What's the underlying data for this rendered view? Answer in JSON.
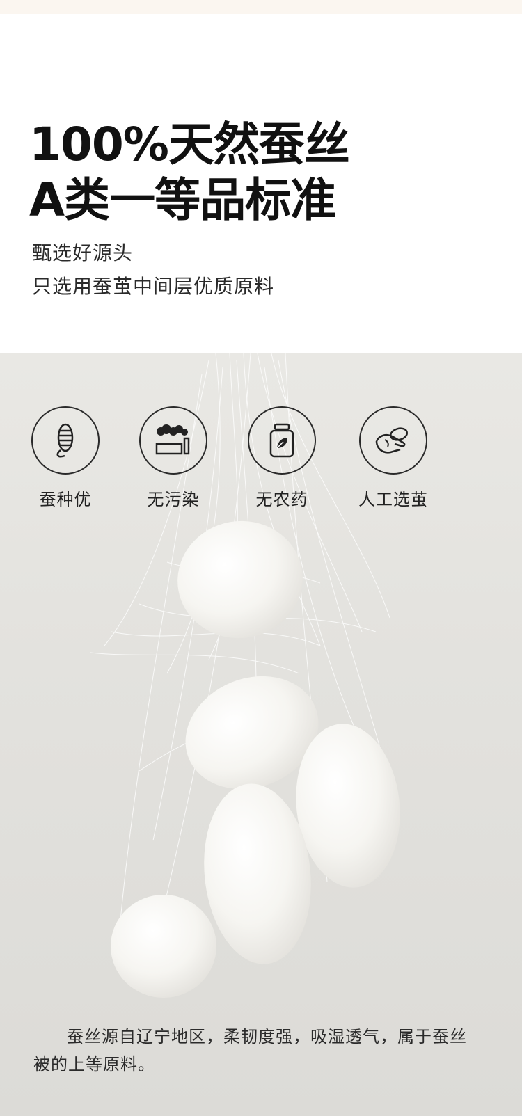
{
  "headline": {
    "line1": "100%天然蚕丝",
    "line2": "A类一等品标准"
  },
  "subline": {
    "line1": "甄选好源头",
    "line2": "只选用蚕茧中间层优质原料"
  },
  "features": [
    {
      "label": "蚕种优",
      "icon": "silkworm-icon"
    },
    {
      "label": "无污染",
      "icon": "factory-smoke-icon"
    },
    {
      "label": "无农药",
      "icon": "jar-leaf-icon"
    },
    {
      "label": "人工选茧",
      "icon": "hand-cocoon-icon"
    }
  ],
  "caption": "蚕丝源自辽宁地区，柔韧度强，吸湿透气，属于蚕丝被的上等原料。",
  "colors": {
    "background_top": "#ffffff",
    "photo_bg": "#e5e4e0",
    "cocoon": "#f7f6f2",
    "text": "#1c1c1c"
  }
}
